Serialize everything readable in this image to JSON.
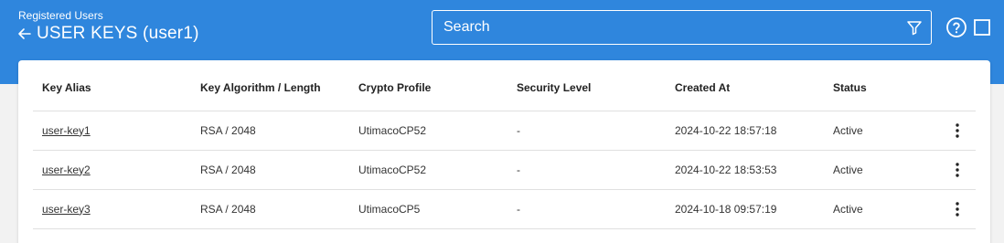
{
  "header": {
    "breadcrumb": "Registered Users",
    "title": "USER KEYS (user1)",
    "search_placeholder": "Search"
  },
  "table": {
    "columns": [
      "Key Alias",
      "Key Algorithm / Length",
      "Crypto Profile",
      "Security Level",
      "Created At",
      "Status"
    ],
    "rows": [
      {
        "alias": "user-key1",
        "algorithm": "RSA / 2048",
        "profile": "UtimacoCP52",
        "security_level": "-",
        "created_at": "2024-10-22 18:57:18",
        "status": "Active"
      },
      {
        "alias": "user-key2",
        "algorithm": "RSA / 2048",
        "profile": "UtimacoCP52",
        "security_level": "-",
        "created_at": "2024-10-22 18:53:53",
        "status": "Active"
      },
      {
        "alias": "user-key3",
        "algorithm": "RSA / 2048",
        "profile": "UtimacoCP5",
        "security_level": "-",
        "created_at": "2024-10-18 09:57:19",
        "status": "Active"
      }
    ]
  },
  "icons": {
    "back": "arrow-left-icon",
    "filter": "filter-icon",
    "help": "help-circle-icon",
    "square": "square-icon",
    "row_menu": "more-vertical-icon"
  },
  "colors": {
    "header_bg": "#2f86dd",
    "page_bg": "#f2f2f2",
    "card_bg": "#ffffff",
    "header_text": "#ffffff"
  }
}
